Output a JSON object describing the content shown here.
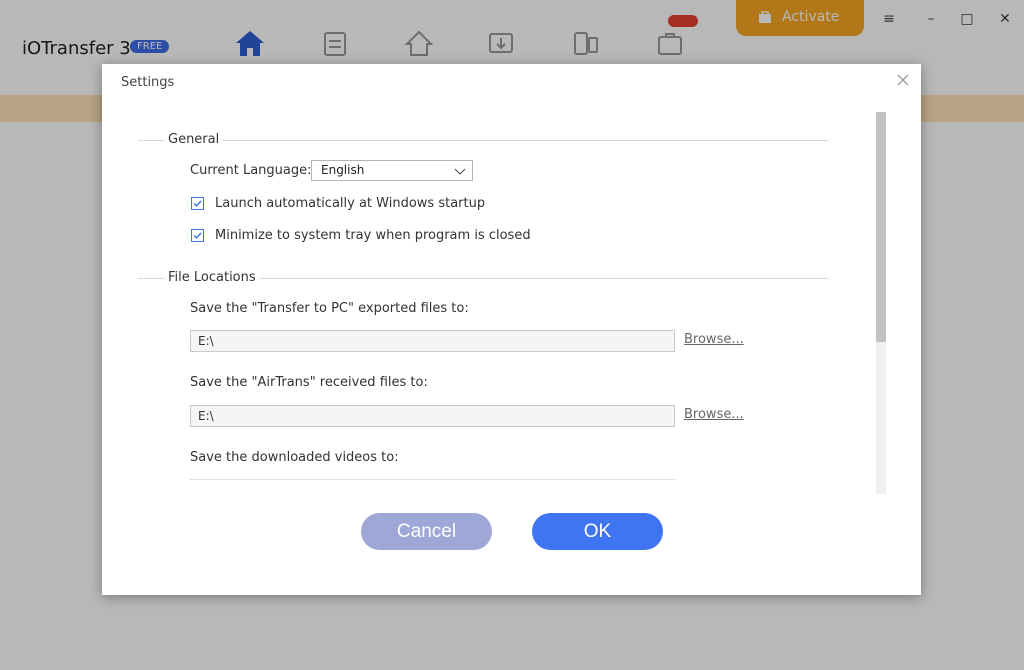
{
  "app": {
    "title": "iOTransfer 3",
    "badge": "FREE",
    "activate_label": "Activate",
    "window_controls": [
      "menu-icon",
      "minimize-icon",
      "maximize-icon",
      "close-icon"
    ]
  },
  "dialog": {
    "title": "Settings",
    "general": {
      "section_title": "General",
      "language_label": "Current Language:",
      "language_value": "English",
      "launch_checked": true,
      "launch_label": "Launch automatically at Windows startup",
      "minimize_checked": true,
      "minimize_label": "Minimize to system tray when program is closed"
    },
    "file_locations": {
      "section_title": "File Locations",
      "transfer_label": "Save the \"Transfer to PC\" exported files to:",
      "transfer_path": "E:\\",
      "airtrans_label": "Save the \"AirTrans\" received files to:",
      "airtrans_path": "E:\\",
      "videos_label": "Save the downloaded videos to:",
      "browse_label": "Browse..."
    },
    "cancel_label": "Cancel",
    "ok_label": "OK"
  },
  "colors": {
    "accent": "#3f75f2",
    "cancel": "#9ea7d6",
    "activate": "#f5a623",
    "banner": "#ffe2b8"
  }
}
